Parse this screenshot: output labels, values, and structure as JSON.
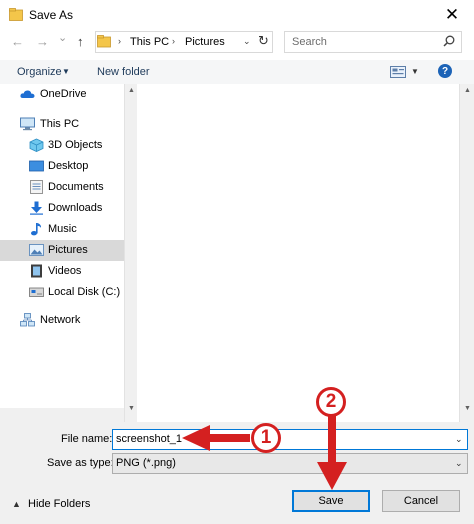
{
  "window": {
    "title": "Save As",
    "close_glyph": "✕"
  },
  "address_bar": {
    "back_glyph": "←",
    "forward_glyph": "→",
    "recent_glyph": "⌄",
    "up_glyph": "↑",
    "breadcrumb": [
      "This PC",
      "Pictures"
    ],
    "separator_glyph": "›",
    "dropdown_glyph": "⌄",
    "refresh_glyph": "↻"
  },
  "search": {
    "placeholder": "Search"
  },
  "toolbar": {
    "organize_label": "Organize",
    "organize_caret": "▼",
    "new_folder_label": "New folder",
    "view_caret": "▼",
    "help_glyph": "?"
  },
  "nav_tree": {
    "items": [
      {
        "label": "OneDrive",
        "icon": "onedrive-cloud-icon"
      },
      {
        "label": "This PC",
        "icon": "computer-icon"
      },
      {
        "label": "3D Objects",
        "icon": "3d-objects-icon"
      },
      {
        "label": "Desktop",
        "icon": "desktop-icon"
      },
      {
        "label": "Documents",
        "icon": "documents-icon"
      },
      {
        "label": "Downloads",
        "icon": "downloads-icon"
      },
      {
        "label": "Music",
        "icon": "music-note-icon"
      },
      {
        "label": "Pictures",
        "icon": "pictures-icon"
      },
      {
        "label": "Videos",
        "icon": "videos-icon"
      },
      {
        "label": "Local Disk (C:)",
        "icon": "local-disk-icon"
      },
      {
        "label": "Network",
        "icon": "network-icon"
      }
    ],
    "selected": "Pictures"
  },
  "form": {
    "file_name_label": "File name:",
    "file_name_value": "screenshot_1",
    "save_as_type_label": "Save as type:",
    "save_as_type_value": "PNG (*.png)",
    "dropdown_glyph": "⌄"
  },
  "footer": {
    "hide_folders_caret": "▲",
    "hide_folders_label": "Hide Folders",
    "save_label": "Save",
    "cancel_label": "Cancel"
  },
  "annotations": {
    "step_1": "1",
    "step_2": "2",
    "color": "#d42020"
  },
  "colors": {
    "accent": "#0078d7",
    "selection": "#d9d9d9",
    "panel": "#f0f0f0",
    "folder": "#f4c64a"
  }
}
